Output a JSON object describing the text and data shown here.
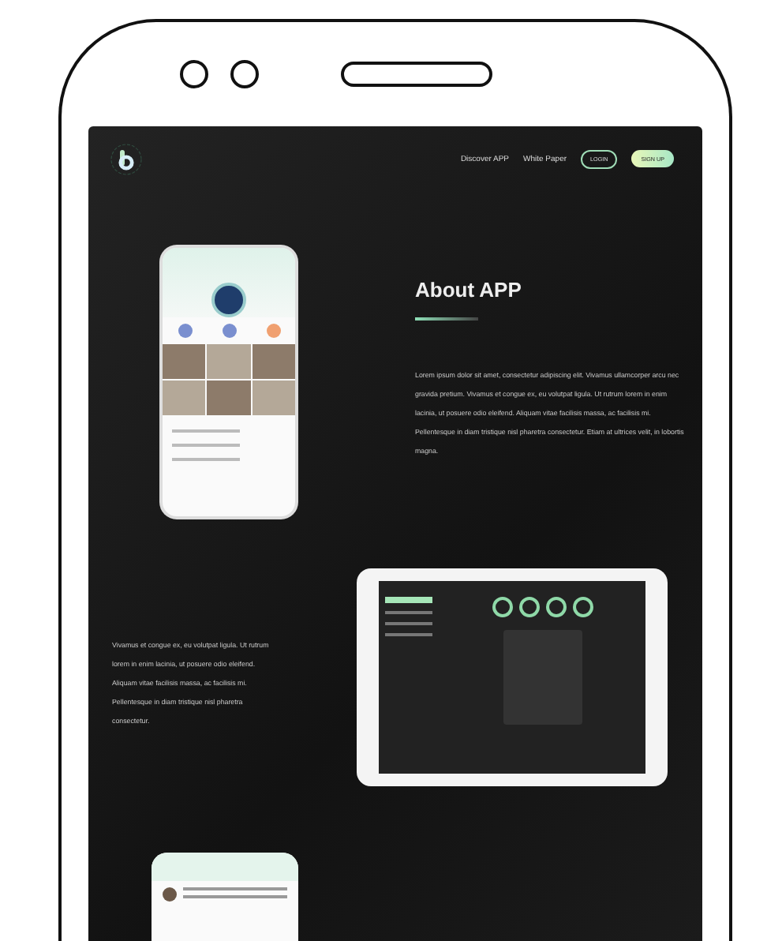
{
  "nav": {
    "links": [
      "Discover APP",
      "White Paper"
    ],
    "buttons": [
      {
        "label": "LOGIN",
        "kind": "outline"
      },
      {
        "label": "SIGN UP",
        "kind": "filled"
      }
    ]
  },
  "about": {
    "title": "About APP",
    "text": "Lorem ipsum dolor sit amet, consectetur adipiscing elit. Vivamus ullamcorper arcu nec gravida pretium. Vivamus et congue ex, eu volutpat ligula. Ut rutrum lorem in enim lacinia, ut posuere odio eleifend. Aliquam vitae facilisis massa, ac facilisis mi. Pellentesque in diam tristique nisl pharetra consectetur. Etiam at ultrices velit, in lobortis magna."
  },
  "feature": {
    "text": "Vivamus et congue ex, eu volutpat ligula. Ut rutrum lorem in enim lacinia, ut posuere odio eleifend. Aliquam vitae facilisis massa, ac facilisis mi. Pellentesque in diam tristique nisl pharetra consectetur."
  }
}
